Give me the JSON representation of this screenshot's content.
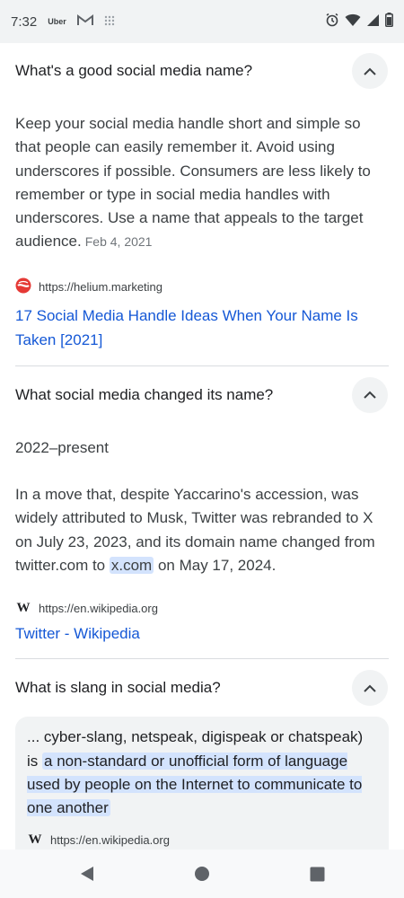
{
  "status_bar": {
    "time": "7:32",
    "uber_label": "Uber",
    "icons": [
      "gmail-icon",
      "grid-icon",
      "alarm-icon",
      "wifi-icon",
      "signal-icon",
      "battery-icon"
    ]
  },
  "questions": [
    {
      "question": "What's a good social media name?",
      "answer": "Keep your social media handle short and simple so that people can easily remember it. Avoid using underscores if possible. Consumers are less likely to remember or type in social media handles with underscores. Use a name that appeals to the target audience.",
      "date": "Feb 4, 2021",
      "source_url": "https://helium.marketing",
      "source_title": "17 Social Media Handle Ideas When Your Name Is Taken [2021]"
    },
    {
      "question": "What social media changed its name?",
      "answer_heading": "2022–present",
      "answer_before": "In a move that, despite Yaccarino's accession, was widely attributed to Musk, Twitter was rebranded to X on July 23, 2023, and its domain name changed from twitter.com to",
      "answer_highlight": "x.com",
      "answer_after": "on May 17, 2024.",
      "source_url": "https://en.wikipedia.org",
      "source_title": "Twitter - Wikipedia"
    },
    {
      "question": "What is slang in social media?",
      "answer_before": "... cyber-slang, netspeak, digispeak or chatspeak) is",
      "answer_highlight": "a non-standard or unofficial form of language used by people on the Internet to communicate to one another",
      "source_url": "https://en.wikipedia.org"
    }
  ],
  "colors": {
    "link": "#1558d6",
    "highlight": "#d3e3fd",
    "status_bg": "#f1f3f4",
    "chevron_bg": "#f1f3f4"
  }
}
